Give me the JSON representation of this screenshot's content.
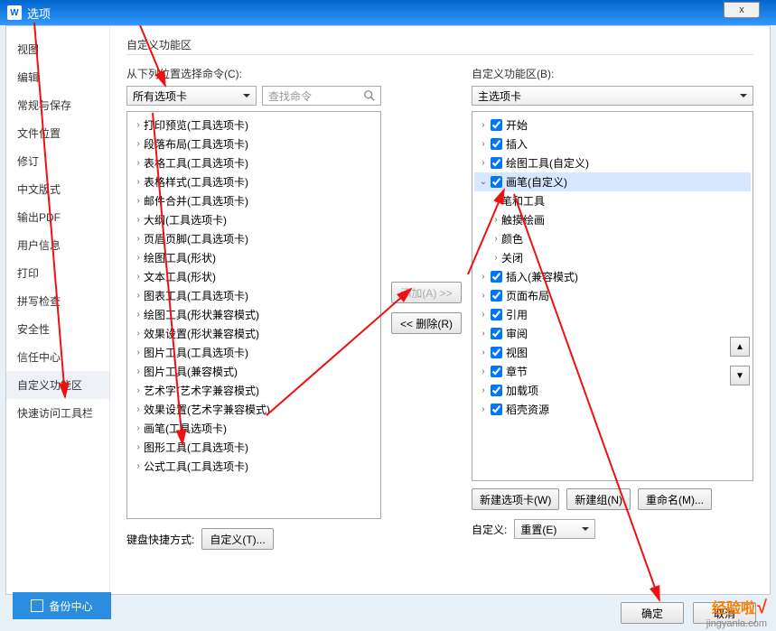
{
  "title": "选项",
  "close": "x",
  "sidebar": {
    "items": [
      {
        "label": "视图"
      },
      {
        "label": "编辑"
      },
      {
        "label": "常规与保存"
      },
      {
        "label": "文件位置"
      },
      {
        "label": "修订"
      },
      {
        "label": "中文版式"
      },
      {
        "label": "输出PDF"
      },
      {
        "label": "用户信息"
      },
      {
        "label": "打印"
      },
      {
        "label": "拼写检查"
      },
      {
        "label": "安全性"
      },
      {
        "label": "信任中心"
      },
      {
        "label": "自定义功能区"
      },
      {
        "label": "快速访问工具栏"
      }
    ],
    "selected": 12,
    "backup": "备份中心"
  },
  "main": {
    "section_title": "自定义功能区",
    "left_label": "从下列位置选择命令(C):",
    "left_dropdown": "所有选项卡",
    "search_placeholder": "查找命令",
    "right_label": "自定义功能区(B):",
    "right_dropdown": "主选项卡",
    "left_tree": [
      "打印预览(工具选项卡)",
      "段落布局(工具选项卡)",
      "表格工具(工具选项卡)",
      "表格样式(工具选项卡)",
      "邮件合并(工具选项卡)",
      "大纲(工具选项卡)",
      "页眉页脚(工具选项卡)",
      "绘图工具(形状)",
      "文本工具(形状)",
      "图表工具(工具选项卡)",
      "绘图工具(形状兼容模式)",
      "效果设置(形状兼容模式)",
      "图片工具(工具选项卡)",
      "图片工具(兼容模式)",
      "艺术字(艺术字兼容模式)",
      "效果设置(艺术字兼容模式)",
      "画笔(工具选项卡)",
      "图形工具(工具选项卡)",
      "公式工具(工具选项卡)"
    ],
    "right_tree": {
      "top": [
        {
          "label": "开始",
          "chk": true
        },
        {
          "label": "插入",
          "chk": true
        },
        {
          "label": "绘图工具(自定义)",
          "chk": true
        }
      ],
      "open": {
        "label": "画笔(自定义)",
        "chk": true
      },
      "children": [
        "笔和工具",
        "触摸绘画",
        "颜色",
        "关闭"
      ],
      "rest": [
        {
          "label": "插入(兼容模式)",
          "chk": true
        },
        {
          "label": "页面布局",
          "chk": true
        },
        {
          "label": "引用",
          "chk": true
        },
        {
          "label": "审阅",
          "chk": true
        },
        {
          "label": "视图",
          "chk": true
        },
        {
          "label": "章节",
          "chk": true
        },
        {
          "label": "加载项",
          "chk": true
        },
        {
          "label": "稻壳资源",
          "chk": true
        }
      ]
    },
    "add_btn": "添加(A) >>",
    "del_btn": "<< 删除(R)",
    "new_tab": "新建选项卡(W)",
    "new_group": "新建组(N)",
    "rename": "重命名(M)...",
    "kb_label": "键盘快捷方式:",
    "kb_btn": "自定义(T)...",
    "custom_label": "自定义:",
    "reset_btn": "重置(E)",
    "up": "▲",
    "down": "▼"
  },
  "footer": {
    "ok": "确定",
    "cancel": "取消"
  },
  "watermark": {
    "brand": "经验啦",
    "check": "√",
    "url": "jingyanla.com"
  }
}
